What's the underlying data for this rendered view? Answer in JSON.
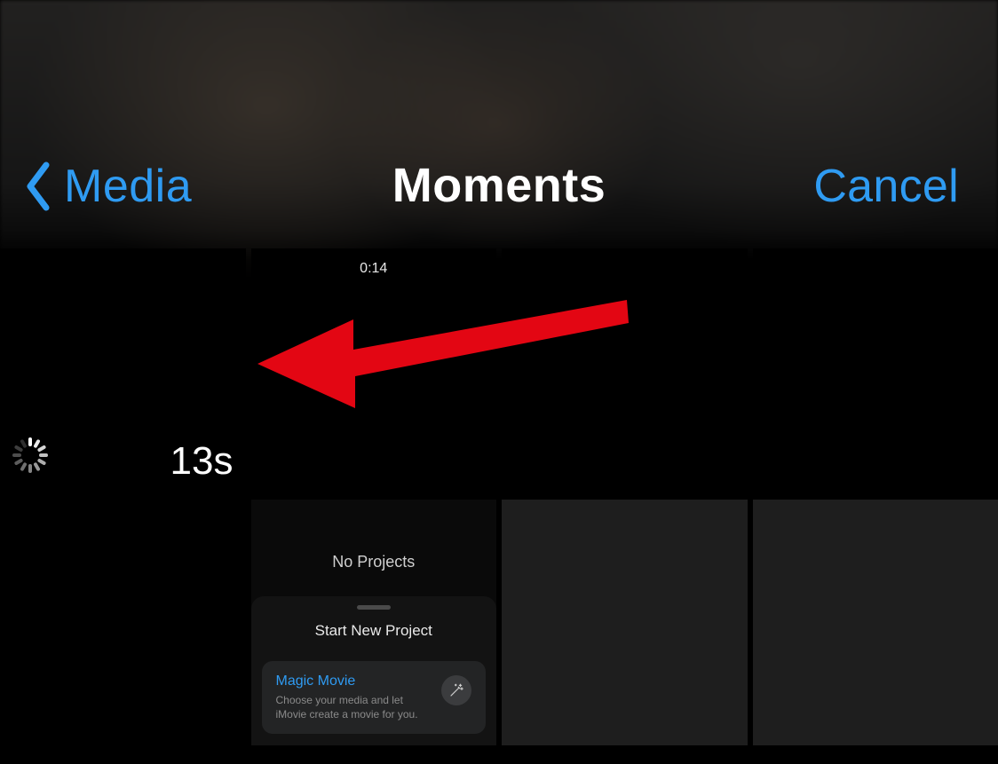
{
  "header": {
    "back_label": "Media",
    "title": "Moments",
    "cancel_label": "Cancel"
  },
  "colors": {
    "accent": "#2f9bf2",
    "arrow": "#e30613"
  },
  "grid": {
    "cells": [
      {
        "kind": "video-loading",
        "duration_label": "13s",
        "loading": true
      },
      {
        "kind": "screenshot-timer",
        "mini_time": "0:14"
      },
      {
        "kind": "empty"
      },
      {
        "kind": "empty"
      },
      {
        "kind": "empty"
      },
      {
        "kind": "imovie-start",
        "no_projects_label": "No Projects",
        "sheet_title": "Start New Project",
        "card": {
          "title": "Magic Movie",
          "desc": "Choose your media and let iMovie create a movie for you.",
          "icon": "magic-wand-icon"
        }
      }
    ]
  },
  "annotation": {
    "arrow_present": true,
    "arrow_direction": "left"
  }
}
